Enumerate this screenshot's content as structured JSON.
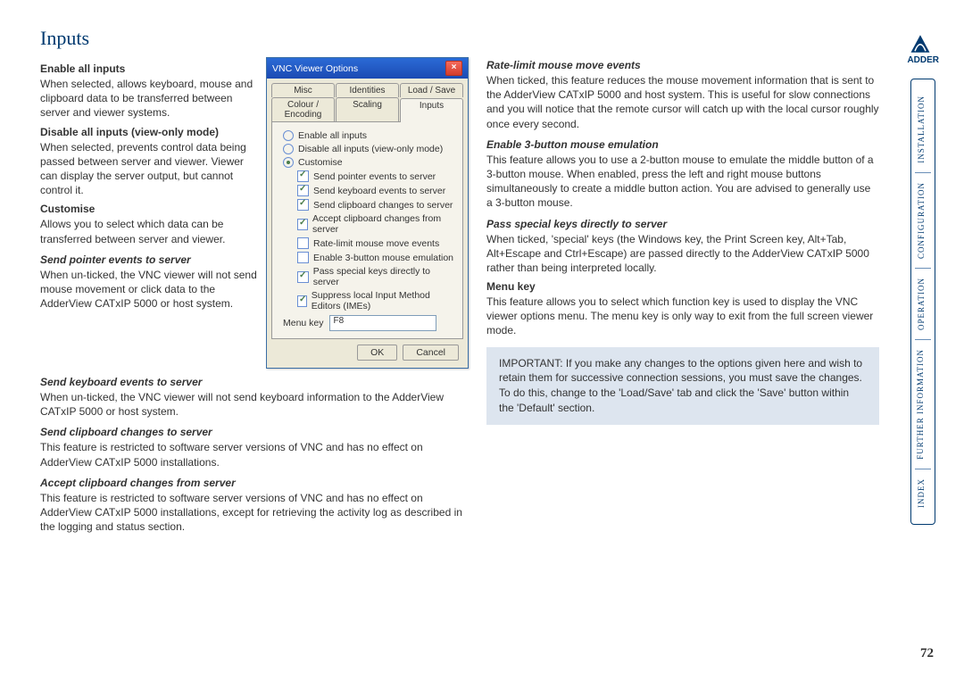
{
  "page_title": "Inputs",
  "page_number": "72",
  "brand": "ADDER",
  "sidebar_nav": [
    "Installation",
    "Configuration",
    "Operation",
    "Further Information",
    "Index"
  ],
  "left": {
    "enable_all_head": "Enable all inputs",
    "enable_all_body": "When selected, allows keyboard, mouse and clipboard data to be transferred between server and viewer systems.",
    "disable_head": "Disable all inputs (view-only mode)",
    "disable_body": "When selected, prevents control data being passed between server and viewer. Viewer can display the server output, but cannot control it.",
    "customise_head": "Customise",
    "customise_body": "Allows you to select which data can be transferred between server and viewer.",
    "send_pointer_head": "Send pointer events to server",
    "send_pointer_body": "When un-ticked, the VNC viewer will not send mouse movement or click data to the AdderView CATxIP 5000 or host system.",
    "send_keyboard_head": "Send keyboard events to server",
    "send_keyboard_body": "When un-ticked, the VNC viewer will not send keyboard information to the AdderView CATxIP 5000 or host system.",
    "send_clip_head": "Send clipboard changes to server",
    "send_clip_body": "This feature is restricted to software server versions of VNC and has no effect on AdderView CATxIP 5000 installations.",
    "accept_clip_head": "Accept clipboard changes from server",
    "accept_clip_body": "This feature is restricted to software server versions of VNC and has no effect on AdderView CATxIP 5000 installations, except for retrieving the activity log as described in the logging and status section."
  },
  "right": {
    "rate_head": "Rate-limit mouse move events",
    "rate_body": "When ticked, this feature reduces the mouse movement information that is sent to the AdderView CATxIP 5000 and host system. This is useful for slow connections and you will notice that the remote cursor will catch up with the local cursor roughly once every second.",
    "three_btn_head": "Enable 3-button mouse emulation",
    "three_btn_body": "This feature allows you to use a 2-button mouse to emulate the middle button of a 3-button mouse. When enabled, press the left and right mouse buttons simultaneously to create a middle button action. You are advised to generally use a 3-button mouse.",
    "pass_keys_head": "Pass special keys directly to server",
    "pass_keys_body": "When ticked, 'special' keys (the Windows key, the Print Screen key, Alt+Tab, Alt+Escape and Ctrl+Escape) are passed directly to the AdderView CATxIP 5000 rather than being interpreted locally.",
    "menu_key_head": "Menu key",
    "menu_key_body": "This feature allows you to select which function key is used to display the VNC viewer options menu. The menu key is only way to exit from the full screen viewer mode.",
    "important": "IMPORTANT: If you make any changes to the options given here and wish to retain them for successive connection sessions, you must save the changes. To do this, change to the 'Load/Save' tab and click the 'Save' button within the 'Default' section."
  },
  "dialog": {
    "title": "VNC Viewer Options",
    "tabs_top": [
      "Misc",
      "Identities",
      "Load / Save"
    ],
    "tabs_bottom": [
      "Colour / Encoding",
      "Scaling",
      "Inputs"
    ],
    "radio_enable": "Enable all inputs",
    "radio_disable": "Disable all inputs (view-only mode)",
    "radio_customise": "Customise",
    "chk_pointer": "Send pointer events to server",
    "chk_keyboard": "Send keyboard events to server",
    "chk_clip_to": "Send clipboard changes to server",
    "chk_clip_from": "Accept clipboard changes from server",
    "chk_rate": "Rate-limit mouse move events",
    "chk_3btn": "Enable 3-button mouse emulation",
    "chk_pass": "Pass special keys directly to server",
    "chk_ime": "Suppress local Input Method Editors (IMEs)",
    "menu_key_label": "Menu key",
    "menu_key_value": "F8",
    "btn_ok": "OK",
    "btn_cancel": "Cancel"
  }
}
